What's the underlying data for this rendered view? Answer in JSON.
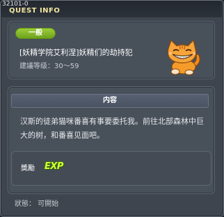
{
  "window": {
    "quest_id": "32101-0",
    "title": "QUEST INFO"
  },
  "quest": {
    "category_badge": "一般",
    "name": "[妖精学院艾利涅]妖精们的劫持犯",
    "level_range": "建議等级：30～59",
    "npc_icon": "orange-cat-npc-icon"
  },
  "content": {
    "header": "内容",
    "text": "汉斯的徒弟猫咪番喜有事要委托我。前往北部森林中巨大的树，和番喜见面吧。"
  },
  "reward": {
    "label": "獎勵",
    "exp_icon_text": "EXP"
  },
  "status": {
    "text": "狀態：  可開始"
  },
  "colors": {
    "badge_green": "#86bb2b",
    "title_yellow": "#f2e6a0",
    "exp_green": "#d6ff3a",
    "panel_bg": "#48505a"
  }
}
